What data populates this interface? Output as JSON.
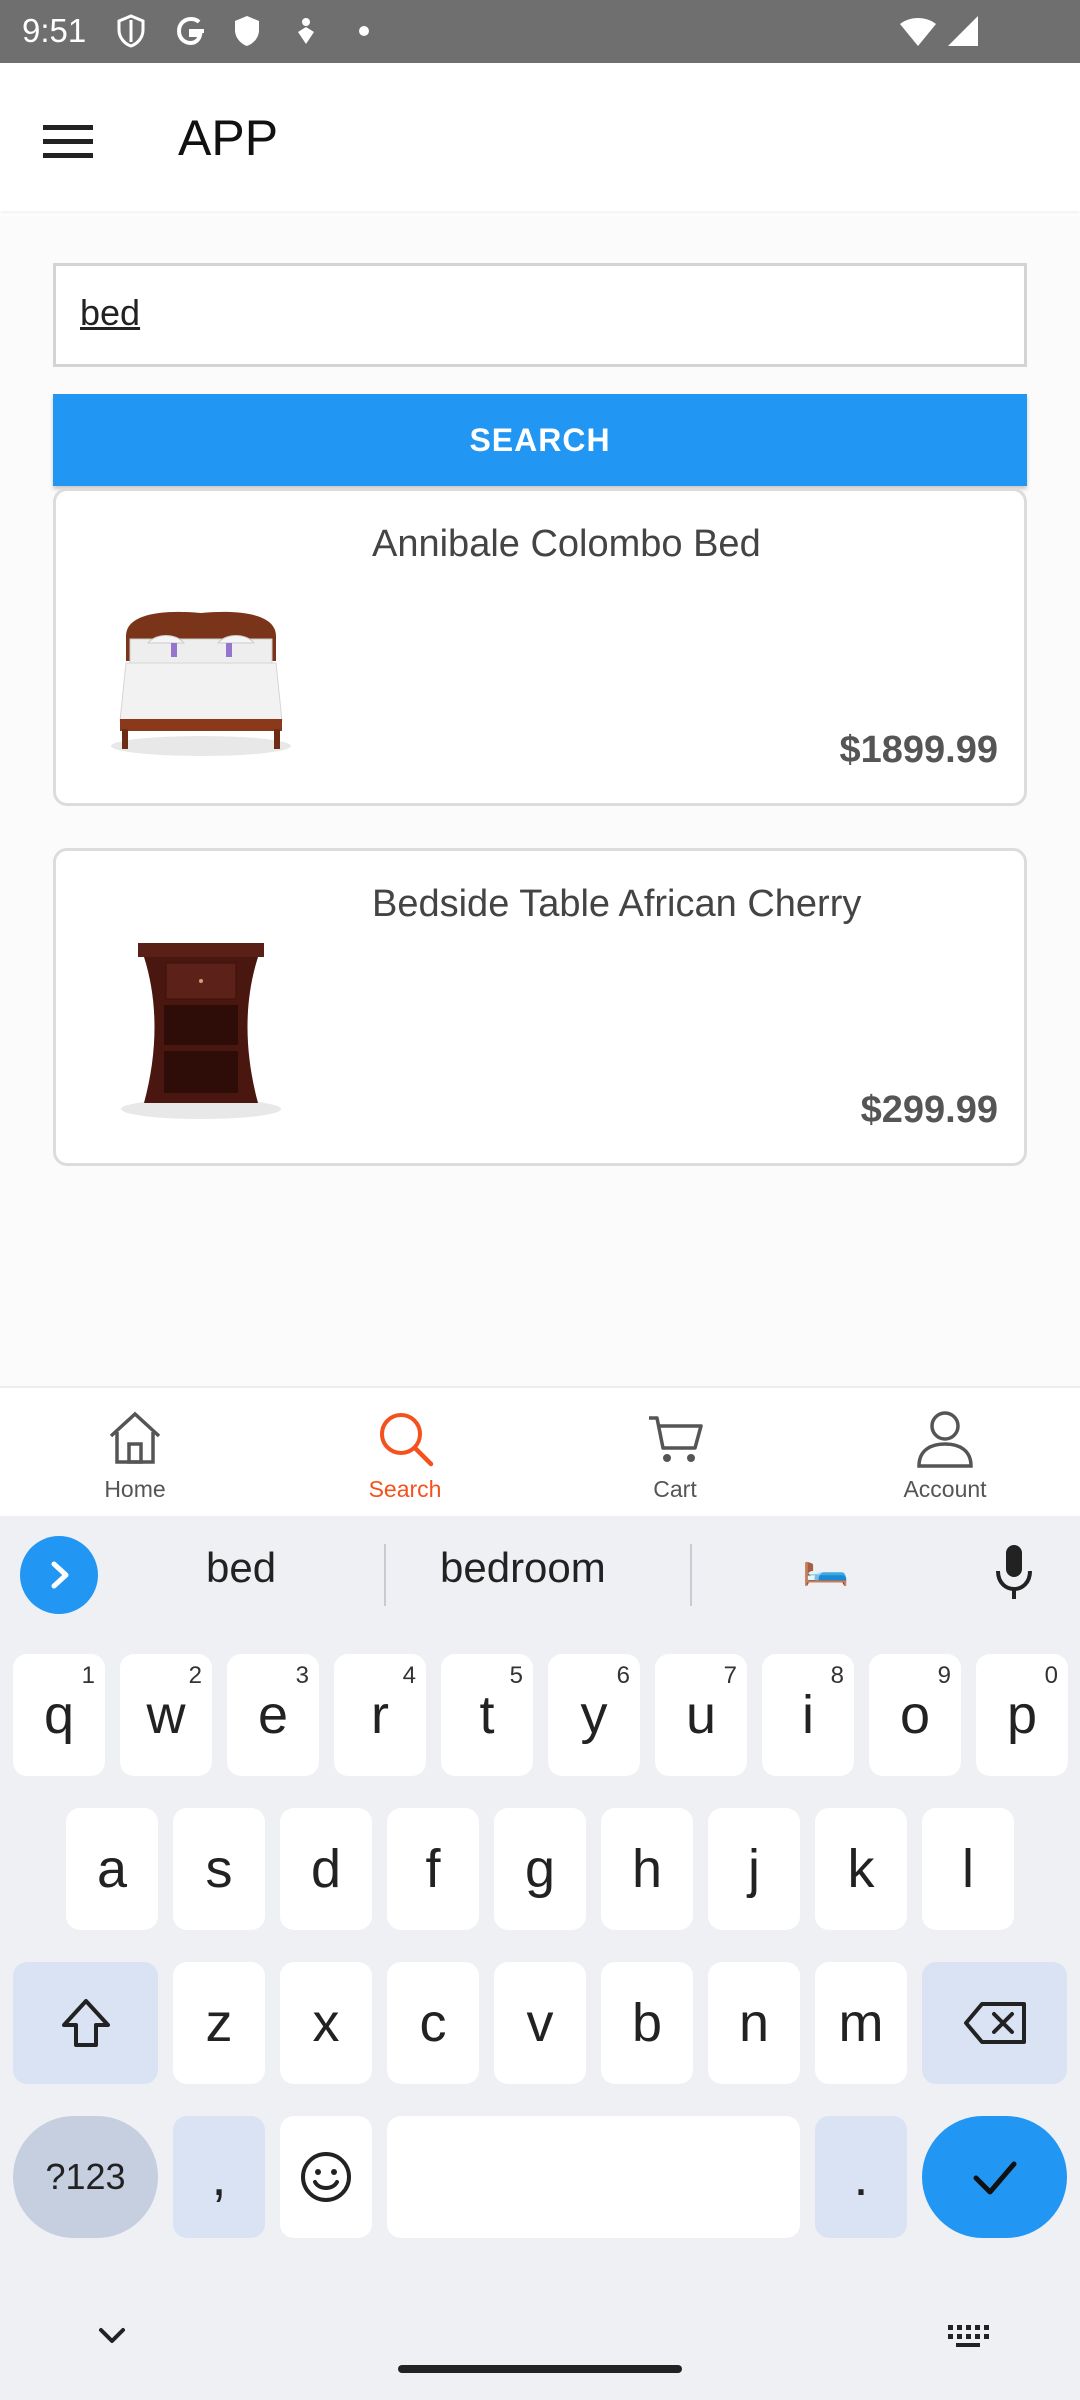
{
  "status_bar": {
    "time": "9:51"
  },
  "app_bar": {
    "title": "APP"
  },
  "search": {
    "query": "bed",
    "button_label": "SEARCH"
  },
  "results": [
    {
      "name": "Annibale Colombo Bed",
      "price": "$1899.99"
    },
    {
      "name": "Bedside Table African Cherry",
      "price": "$299.99"
    }
  ],
  "bottom_nav": {
    "items": [
      {
        "label": "Home",
        "icon": "home-icon"
      },
      {
        "label": "Search",
        "icon": "search-icon",
        "active": true
      },
      {
        "label": "Cart",
        "icon": "cart-icon"
      },
      {
        "label": "Account",
        "icon": "account-icon"
      }
    ],
    "active_color": "#f4511e"
  },
  "keyboard": {
    "suggestions": [
      "bed",
      "bedroom",
      "🛏️"
    ],
    "row1": [
      "q",
      "w",
      "e",
      "r",
      "t",
      "y",
      "u",
      "i",
      "o",
      "p"
    ],
    "row1_hints": [
      "1",
      "2",
      "3",
      "4",
      "5",
      "6",
      "7",
      "8",
      "9",
      "0"
    ],
    "row2": [
      "a",
      "s",
      "d",
      "f",
      "g",
      "h",
      "j",
      "k",
      "l"
    ],
    "row3": [
      "z",
      "x",
      "c",
      "v",
      "b",
      "n",
      "m"
    ],
    "symbols_key": "?123",
    "comma_key": ",",
    "period_key": "."
  },
  "colors": {
    "primary": "#2196f3",
    "accent": "#f4511e"
  }
}
